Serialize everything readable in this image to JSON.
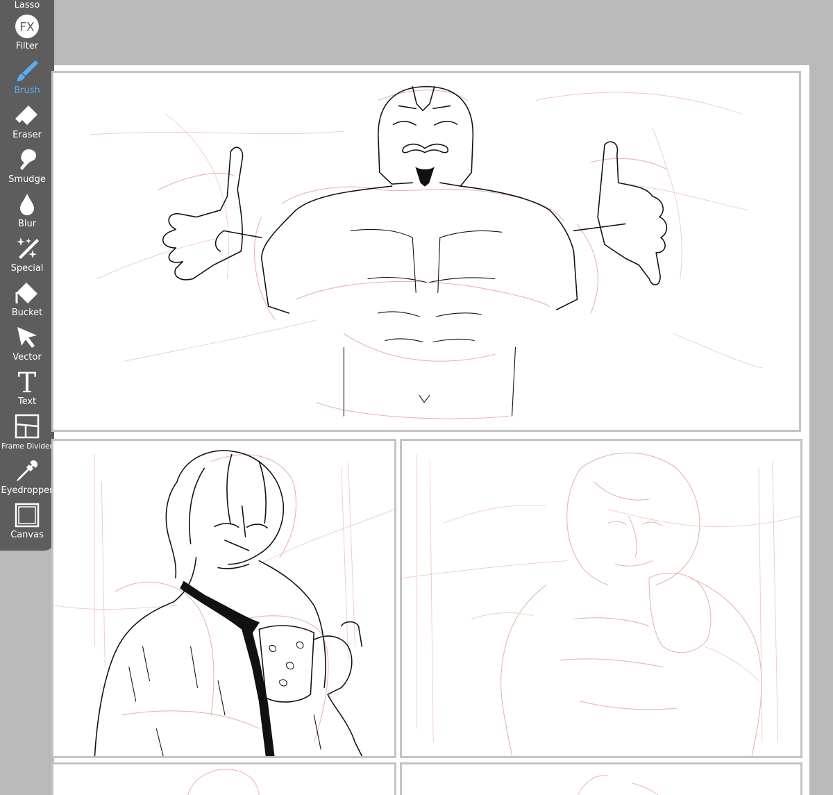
{
  "toolbar": {
    "tools": [
      {
        "label": "Lasso",
        "icon": "lasso-icon"
      },
      {
        "label": "Filter",
        "icon": "fx-icon"
      },
      {
        "label": "Brush",
        "icon": "brush-icon",
        "active": true
      },
      {
        "label": "Eraser",
        "icon": "eraser-icon"
      },
      {
        "label": "Smudge",
        "icon": "smudge-icon"
      },
      {
        "label": "Blur",
        "icon": "blur-icon"
      },
      {
        "label": "Special",
        "icon": "special-icon"
      },
      {
        "label": "Bucket",
        "icon": "bucket-icon"
      },
      {
        "label": "Vector",
        "icon": "vector-icon"
      },
      {
        "label": "Text",
        "icon": "text-icon"
      },
      {
        "label": "Frame Divider",
        "icon": "frame-divider-icon"
      },
      {
        "label": "Eyedropper",
        "icon": "eyedropper-icon"
      },
      {
        "label": "Canvas",
        "icon": "canvas-icon"
      }
    ],
    "fx_glyph": "FX",
    "text_glyph": "T",
    "active_color": "#5aaef0",
    "background_color": "#5d5d5d"
  },
  "workspace": {
    "background_color": "#b9b9b9",
    "page_color": "#ffffff",
    "frame_border_color": "#c3c3c3",
    "sketch_color": "#eab3ad",
    "ink_color": "#111111"
  }
}
